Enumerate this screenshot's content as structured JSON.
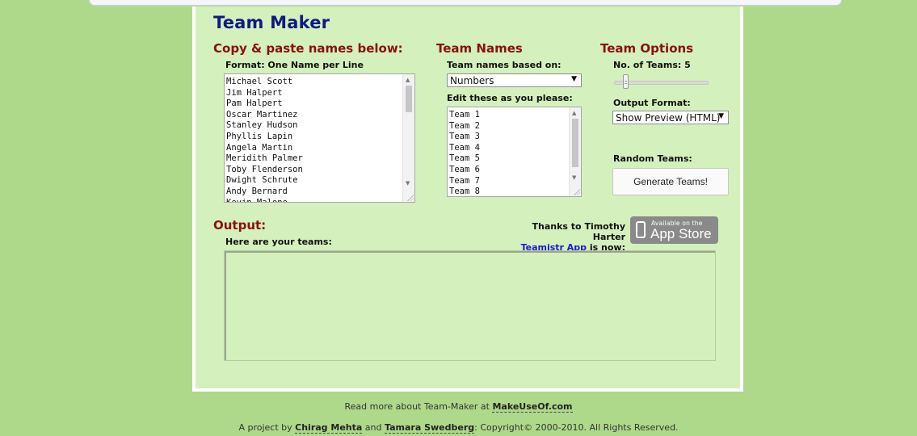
{
  "title": "Team Maker",
  "names_section": {
    "heading": "Copy & paste names below:",
    "format_label": "Format: One Name per Line",
    "names": [
      "Michael Scott",
      "Jim Halpert",
      "Pam Halpert",
      "Oscar Martinez",
      "Stanley Hudson",
      "Phyllis Lapin",
      "Angela Martin",
      "Meridith Palmer",
      "Toby Flenderson",
      "Dwight Schrute",
      "Andy Bernard",
      "Kevin Malone"
    ]
  },
  "team_names_section": {
    "heading": "Team Names",
    "based_on_label": "Team names based on:",
    "based_on_value": "Numbers",
    "edit_label": "Edit these as you please:",
    "teams": [
      "Team 1",
      "Team 2",
      "Team 3",
      "Team 4",
      "Team 5",
      "Team 6",
      "Team 7",
      "Team 8"
    ]
  },
  "team_options_section": {
    "heading": "Team Options",
    "num_teams_label": "No. of Teams: 5",
    "num_teams": 5,
    "output_format_label": "Output Format:",
    "output_format_value": "Show Preview (HTML)",
    "random_label": "Random Teams:",
    "generate_button": "Generate Teams!"
  },
  "output_section": {
    "heading": "Output:",
    "sub_label": "Here are your teams:",
    "thanks_line1": "Thanks to Timothy Harter",
    "app_link": "Teamistr App",
    "thanks_line2_suffix": " is now:",
    "badge_small": "Available on the",
    "badge_big": "App Store"
  },
  "footer": {
    "line1_prefix": "Read more about Team-Maker at ",
    "line1_link": "MakeUseOf.com",
    "line2_prefix": "A project by ",
    "author1": "Chirag Mehta",
    "and": " and ",
    "author2": "Tamara Swedberg",
    "line2_suffix": ": Copyright© 2000-2010. All Rights Reserved."
  },
  "colors": {
    "page_bg": "#aed98a",
    "panel_bg": "#d4f0bc",
    "title": "#0f1a84",
    "section_heading": "#8b1010",
    "link": "#1a1ad6"
  }
}
